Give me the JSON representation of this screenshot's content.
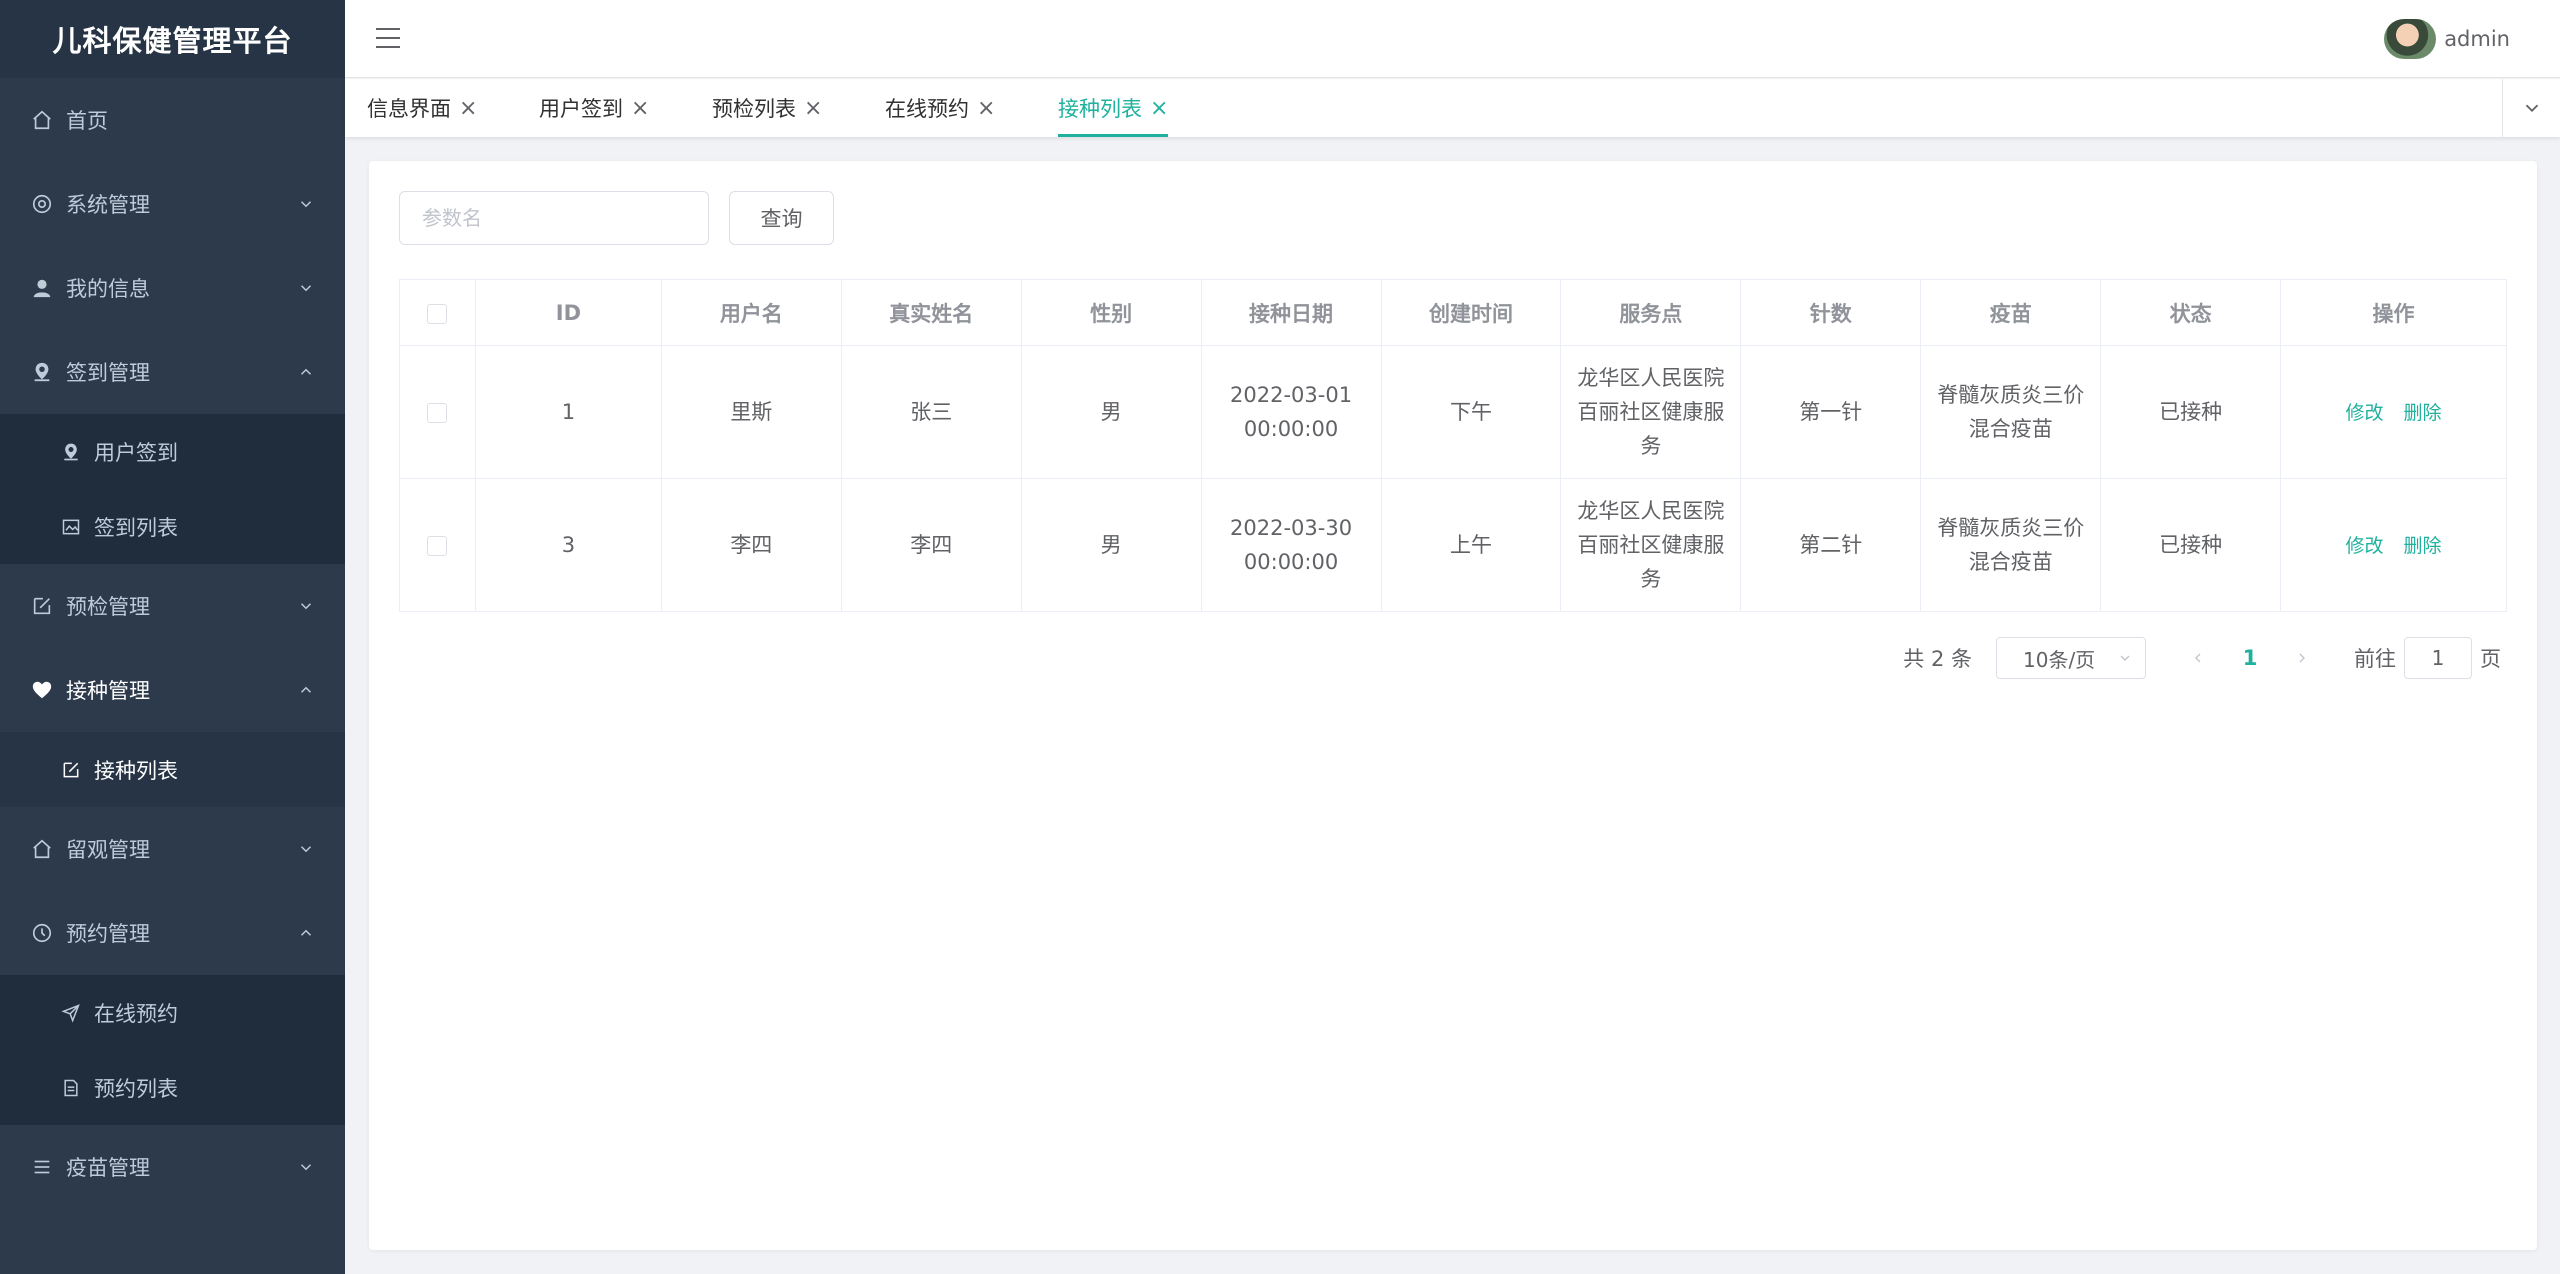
{
  "app": {
    "title": "儿科保健管理平台"
  },
  "header": {
    "username": "admin"
  },
  "sidebar": {
    "home": "首页",
    "system": "系统管理",
    "myinfo": "我的信息",
    "signin": {
      "label": "签到管理",
      "items": [
        "用户签到",
        "签到列表"
      ]
    },
    "precheck": "预检管理",
    "vaccination": {
      "label": "接种管理",
      "items": [
        "接种列表"
      ]
    },
    "observation": "留观管理",
    "appointment": {
      "label": "预约管理",
      "items": [
        "在线预约",
        "预约列表"
      ]
    },
    "vaccine": "疫苗管理"
  },
  "tabs": [
    {
      "label": "信息界面"
    },
    {
      "label": "用户签到"
    },
    {
      "label": "预检列表"
    },
    {
      "label": "在线预约"
    },
    {
      "label": "接种列表",
      "active": true
    }
  ],
  "search": {
    "placeholder": "参数名",
    "button": "查询"
  },
  "table": {
    "headers": [
      "ID",
      "用户名",
      "真实姓名",
      "性别",
      "接种日期",
      "创建时间",
      "服务点",
      "针数",
      "疫苗",
      "状态",
      "操作"
    ],
    "rows": [
      {
        "id": "1",
        "username": "里斯",
        "realname": "张三",
        "gender": "男",
        "date": "2022-03-01 00:00:00",
        "created": "下午",
        "service": "龙华区人民医院百丽社区健康服务",
        "dose": "第一针",
        "vaccine": "脊髓灰质炎三价混合疫苗",
        "status": "已接种"
      },
      {
        "id": "3",
        "username": "李四",
        "realname": "李四",
        "gender": "男",
        "date": "2022-03-30 00:00:00",
        "created": "上午",
        "service": "龙华区人民医院百丽社区健康服务",
        "dose": "第二针",
        "vaccine": "脊髓灰质炎三价混合疫苗",
        "status": "已接种"
      }
    ],
    "actions": {
      "edit": "修改",
      "delete": "删除"
    }
  },
  "pagination": {
    "total": "共 2 条",
    "page_size": "10条/页",
    "current": "1",
    "goto_prefix": "前往",
    "goto_value": "1",
    "goto_suffix": "页"
  },
  "colors": {
    "sidebar": "#2d3a4b",
    "accent": "#1fb19e",
    "active_bg": "#263445"
  }
}
